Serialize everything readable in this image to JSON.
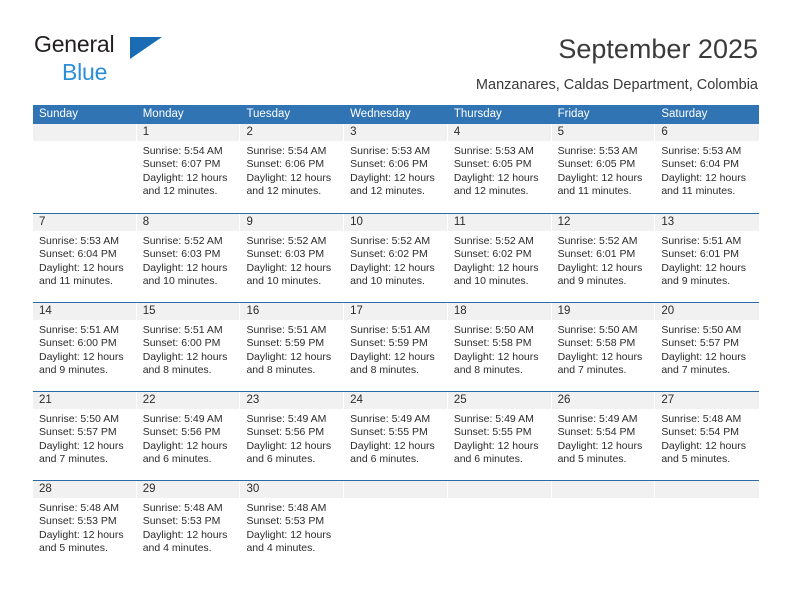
{
  "brand": {
    "name_top": "General",
    "name_bottom": "Blue",
    "triangle_color": "#1a6cb5",
    "text_color_bottom": "#2a8fd8"
  },
  "header": {
    "title": "September 2025",
    "subtitle": "Manzanares, Caldas Department, Colombia"
  },
  "theme": {
    "header_row_bg": "#3174b4",
    "week_divider": "#2b6ca8",
    "daynum_bg": "#f1f1f1",
    "text": "#2b2b2b"
  },
  "calendar": {
    "weekday_headers": [
      "Sunday",
      "Monday",
      "Tuesday",
      "Wednesday",
      "Thursday",
      "Friday",
      "Saturday"
    ],
    "weeks": [
      [
        {
          "day": "",
          "empty": true,
          "lines": []
        },
        {
          "day": "1",
          "lines": [
            "Sunrise: 5:54 AM",
            "Sunset: 6:07 PM",
            "Daylight: 12 hours",
            "and 12 minutes."
          ]
        },
        {
          "day": "2",
          "lines": [
            "Sunrise: 5:54 AM",
            "Sunset: 6:06 PM",
            "Daylight: 12 hours",
            "and 12 minutes."
          ]
        },
        {
          "day": "3",
          "lines": [
            "Sunrise: 5:53 AM",
            "Sunset: 6:06 PM",
            "Daylight: 12 hours",
            "and 12 minutes."
          ]
        },
        {
          "day": "4",
          "lines": [
            "Sunrise: 5:53 AM",
            "Sunset: 6:05 PM",
            "Daylight: 12 hours",
            "and 12 minutes."
          ]
        },
        {
          "day": "5",
          "lines": [
            "Sunrise: 5:53 AM",
            "Sunset: 6:05 PM",
            "Daylight: 12 hours",
            "and 11 minutes."
          ]
        },
        {
          "day": "6",
          "lines": [
            "Sunrise: 5:53 AM",
            "Sunset: 6:04 PM",
            "Daylight: 12 hours",
            "and 11 minutes."
          ]
        }
      ],
      [
        {
          "day": "7",
          "lines": [
            "Sunrise: 5:53 AM",
            "Sunset: 6:04 PM",
            "Daylight: 12 hours",
            "and 11 minutes."
          ]
        },
        {
          "day": "8",
          "lines": [
            "Sunrise: 5:52 AM",
            "Sunset: 6:03 PM",
            "Daylight: 12 hours",
            "and 10 minutes."
          ]
        },
        {
          "day": "9",
          "lines": [
            "Sunrise: 5:52 AM",
            "Sunset: 6:03 PM",
            "Daylight: 12 hours",
            "and 10 minutes."
          ]
        },
        {
          "day": "10",
          "lines": [
            "Sunrise: 5:52 AM",
            "Sunset: 6:02 PM",
            "Daylight: 12 hours",
            "and 10 minutes."
          ]
        },
        {
          "day": "11",
          "lines": [
            "Sunrise: 5:52 AM",
            "Sunset: 6:02 PM",
            "Daylight: 12 hours",
            "and 10 minutes."
          ]
        },
        {
          "day": "12",
          "lines": [
            "Sunrise: 5:52 AM",
            "Sunset: 6:01 PM",
            "Daylight: 12 hours",
            "and 9 minutes."
          ]
        },
        {
          "day": "13",
          "lines": [
            "Sunrise: 5:51 AM",
            "Sunset: 6:01 PM",
            "Daylight: 12 hours",
            "and 9 minutes."
          ]
        }
      ],
      [
        {
          "day": "14",
          "lines": [
            "Sunrise: 5:51 AM",
            "Sunset: 6:00 PM",
            "Daylight: 12 hours",
            "and 9 minutes."
          ]
        },
        {
          "day": "15",
          "lines": [
            "Sunrise: 5:51 AM",
            "Sunset: 6:00 PM",
            "Daylight: 12 hours",
            "and 8 minutes."
          ]
        },
        {
          "day": "16",
          "lines": [
            "Sunrise: 5:51 AM",
            "Sunset: 5:59 PM",
            "Daylight: 12 hours",
            "and 8 minutes."
          ]
        },
        {
          "day": "17",
          "lines": [
            "Sunrise: 5:51 AM",
            "Sunset: 5:59 PM",
            "Daylight: 12 hours",
            "and 8 minutes."
          ]
        },
        {
          "day": "18",
          "lines": [
            "Sunrise: 5:50 AM",
            "Sunset: 5:58 PM",
            "Daylight: 12 hours",
            "and 8 minutes."
          ]
        },
        {
          "day": "19",
          "lines": [
            "Sunrise: 5:50 AM",
            "Sunset: 5:58 PM",
            "Daylight: 12 hours",
            "and 7 minutes."
          ]
        },
        {
          "day": "20",
          "lines": [
            "Sunrise: 5:50 AM",
            "Sunset: 5:57 PM",
            "Daylight: 12 hours",
            "and 7 minutes."
          ]
        }
      ],
      [
        {
          "day": "21",
          "lines": [
            "Sunrise: 5:50 AM",
            "Sunset: 5:57 PM",
            "Daylight: 12 hours",
            "and 7 minutes."
          ]
        },
        {
          "day": "22",
          "lines": [
            "Sunrise: 5:49 AM",
            "Sunset: 5:56 PM",
            "Daylight: 12 hours",
            "and 6 minutes."
          ]
        },
        {
          "day": "23",
          "lines": [
            "Sunrise: 5:49 AM",
            "Sunset: 5:56 PM",
            "Daylight: 12 hours",
            "and 6 minutes."
          ]
        },
        {
          "day": "24",
          "lines": [
            "Sunrise: 5:49 AM",
            "Sunset: 5:55 PM",
            "Daylight: 12 hours",
            "and 6 minutes."
          ]
        },
        {
          "day": "25",
          "lines": [
            "Sunrise: 5:49 AM",
            "Sunset: 5:55 PM",
            "Daylight: 12 hours",
            "and 6 minutes."
          ]
        },
        {
          "day": "26",
          "lines": [
            "Sunrise: 5:49 AM",
            "Sunset: 5:54 PM",
            "Daylight: 12 hours",
            "and 5 minutes."
          ]
        },
        {
          "day": "27",
          "lines": [
            "Sunrise: 5:48 AM",
            "Sunset: 5:54 PM",
            "Daylight: 12 hours",
            "and 5 minutes."
          ]
        }
      ],
      [
        {
          "day": "28",
          "lines": [
            "Sunrise: 5:48 AM",
            "Sunset: 5:53 PM",
            "Daylight: 12 hours",
            "and 5 minutes."
          ]
        },
        {
          "day": "29",
          "lines": [
            "Sunrise: 5:48 AM",
            "Sunset: 5:53 PM",
            "Daylight: 12 hours",
            "and 4 minutes."
          ]
        },
        {
          "day": "30",
          "lines": [
            "Sunrise: 5:48 AM",
            "Sunset: 5:53 PM",
            "Daylight: 12 hours",
            "and 4 minutes."
          ]
        },
        {
          "day": "",
          "empty": true,
          "lines": []
        },
        {
          "day": "",
          "empty": true,
          "lines": []
        },
        {
          "day": "",
          "empty": true,
          "lines": []
        },
        {
          "day": "",
          "empty": true,
          "lines": []
        }
      ]
    ]
  }
}
